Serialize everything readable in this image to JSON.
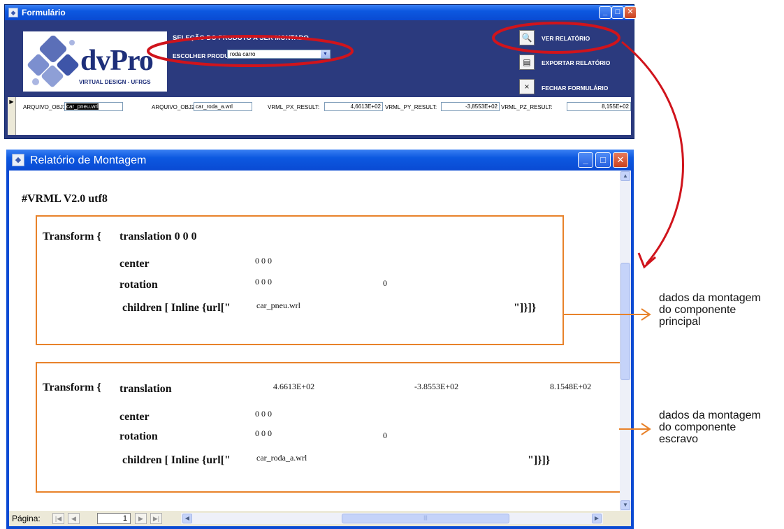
{
  "form_window": {
    "title": "Formulário",
    "logo": {
      "brand": "dvPro",
      "tagline": "VIRTUAL DESIGN - UFRGS"
    },
    "section_title": "SELEÇÃO DO PRODUTO A SER MONTADO",
    "choose_label": "ESCOLHER PRODUTO:",
    "product_value": "roda carro",
    "buttons": {
      "view_report": "VER RELATÓRIO",
      "export_report": "EXPORTAR RELATÓRIO",
      "close_form": "FECHAR FORMULÁRIO"
    },
    "fields": [
      {
        "label": "ARQUIVO_OBJ1:",
        "value": "car_pneu.wrl"
      },
      {
        "label": "ARQUIVO_OBJ2:",
        "value": "car_roda_a.wrl"
      },
      {
        "label": "VRML_PX_RESULT:",
        "value": "4,6613E+02"
      },
      {
        "label": "VRML_PY_RESULT:",
        "value": "-3,8553E+02"
      },
      {
        "label": "VRML_PZ_RESULT:",
        "value": "8,155E+02"
      }
    ]
  },
  "report_window": {
    "title": "Relatório de Montagem",
    "header": "#VRML V2.0 utf8",
    "block1": {
      "transform": "Transform {",
      "translation": "translation 0 0 0",
      "center_label": "center",
      "center_value": "0 0 0",
      "rotation_label": "rotation",
      "rotation_value": "0 0 0",
      "rotation_angle": "0",
      "children_label": "children [ Inline {url[\"",
      "children_file": "car_pneu.wrl",
      "children_end": "\"]}]}"
    },
    "block2": {
      "transform": "Transform {",
      "translation_label": "translation",
      "tx": "4.6613E+02",
      "ty": "-3.8553E+02",
      "tz": "8.1548E+02",
      "center_label": "center",
      "center_value": "0 0 0",
      "rotation_label": "rotation",
      "rotation_value": "0 0 0",
      "rotation_angle": "0",
      "children_label": "children [ Inline {url[\"",
      "children_file": "car_roda_a.wrl",
      "children_end": "\"]}]}"
    },
    "status": {
      "page_label": "Página:",
      "page_number": "1"
    }
  },
  "annotations": {
    "principal": [
      "dados da montagem",
      "do componente",
      "principal"
    ],
    "escravo": [
      "dados da montagem",
      "do componente",
      "escravo"
    ]
  },
  "colors": {
    "highlight_ellipse": "#d0141c",
    "annotation_box": "#e8822a",
    "form_bg": "#2b3a7e"
  }
}
